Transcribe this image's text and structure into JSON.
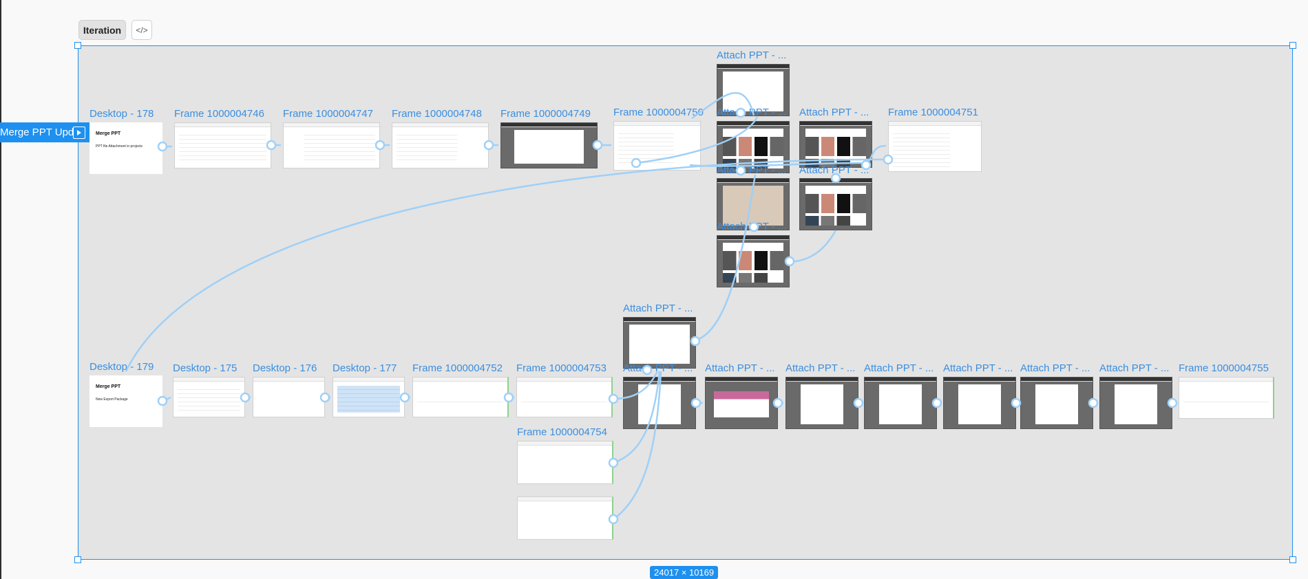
{
  "toolbar": {
    "iteration_label": "Iteration",
    "code_label": "</>",
    "code_icon": "code-icon"
  },
  "selection": {
    "dimensions": "24017 × 10169"
  },
  "flow_start": {
    "label": "Merge PPT Upd...",
    "icon": "play-frame-icon"
  },
  "frames": {
    "desktop_178": {
      "label": "Desktop - 178",
      "title": "Merge PPT",
      "subtitle": "PPT file Attachment in projects"
    },
    "f4746": {
      "label": "Frame 1000004746"
    },
    "f4747": {
      "label": "Frame 1000004747"
    },
    "f4748": {
      "label": "Frame 1000004748"
    },
    "f4749": {
      "label": "Frame 1000004749"
    },
    "f4750": {
      "label": "Frame 1000004750"
    },
    "attach_a": {
      "label": "Attach PPT - ..."
    },
    "attach_b": {
      "label": "Attach PPT - ..."
    },
    "attach_c": {
      "label": "Attach PPT - ..."
    },
    "attach_d": {
      "label": "Attach PPT - ..."
    },
    "attach_e": {
      "label": "Attach PPT - ..."
    },
    "attach_f": {
      "label": "Attach PPT - ..."
    },
    "f4751": {
      "label": "Frame 1000004751"
    },
    "desktop_179": {
      "label": "Desktop - 179",
      "title": "Merge PPT",
      "subtitle": "New Export Package"
    },
    "desktop_175": {
      "label": "Desktop - 175"
    },
    "desktop_176": {
      "label": "Desktop - 176"
    },
    "desktop_177": {
      "label": "Desktop - 177"
    },
    "f4752": {
      "label": "Frame 1000004752"
    },
    "f4753": {
      "label": "Frame 1000004753"
    },
    "f4754": {
      "label": "Frame 1000004754"
    },
    "attach_g": {
      "label": "Attach PPT - ..."
    },
    "attach_h": {
      "label": "Attach PPT - ..."
    },
    "attach_i": {
      "label": "Attach PPT - ..."
    },
    "attach_j": {
      "label": "Attach PPT - ..."
    },
    "attach_k": {
      "label": "Attach PPT - ..."
    },
    "attach_l": {
      "label": "Attach PPT - ..."
    },
    "attach_m": {
      "label": "Attach PPT - ..."
    },
    "attach_n": {
      "label": "Attach PPT - ..."
    },
    "f4755": {
      "label": "Frame 1000004755"
    }
  }
}
